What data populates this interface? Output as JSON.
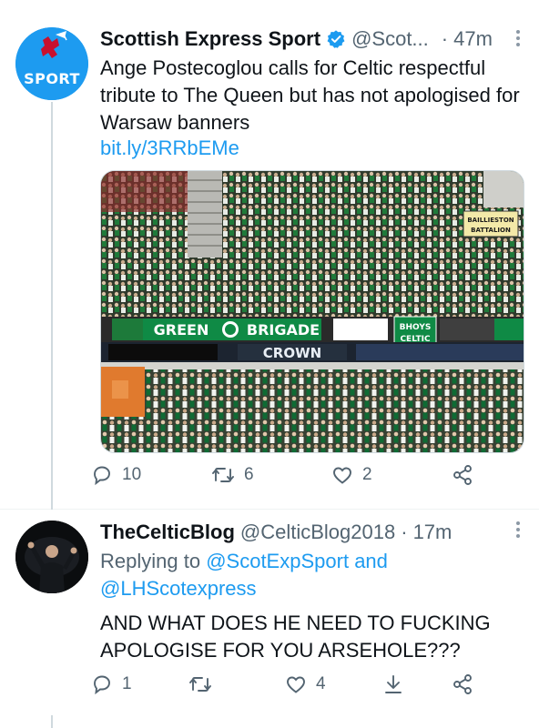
{
  "tweets": [
    {
      "avatar_label": "SPORT",
      "display_name": "Scottish Express Sport",
      "handle": "@Scot...",
      "separator": "·",
      "time": "47m",
      "text": "Ange Postecoglou calls for Celtic respectful tribute to The Queen but has not apologised for Warsaw banners",
      "link": "bit.ly/3RRbEMe",
      "media": {
        "banners": [
          "GREEN",
          "BRIGADE",
          "BHOYS CELTIC",
          "CROWN",
          "BAILLIESTON BATTALION"
        ]
      },
      "actions": {
        "replies": "10",
        "retweets": "6",
        "likes": "2"
      }
    },
    {
      "display_name": "TheCelticBlog",
      "handle": "@CelticBlog2018",
      "separator": "·",
      "time": "17m",
      "replying_label": "Replying to",
      "mention1": "@ScotExpSport",
      "and_label": "and",
      "mention2": "@LHScotexpress",
      "text": "AND WHAT DOES HE NEED TO FUCKING APOLOGISE FOR YOU ARSEHOLE???",
      "actions": {
        "replies": "1",
        "retweets": "",
        "likes": "4"
      }
    }
  ],
  "colors": {
    "accent": "#1d9bf0",
    "secondary_text": "#536471",
    "primary_text": "#0f1419"
  }
}
